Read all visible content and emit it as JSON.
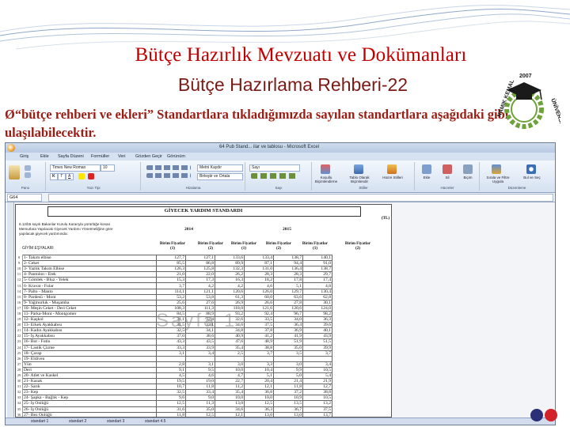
{
  "slide": {
    "title": "Bütçe Hazırlık Mevzuatı ve Dokümanları",
    "subtitle": "Bütçe Hazırlama Rehberi-22",
    "bullet_arrow": "Ø",
    "bullet_text": "“bütçe rehberi ve ekleri” Standartlara tıkladığımızda sayılan standartlara aşağıdaki gibi ulaşılabilecektir."
  },
  "logo": {
    "top_text": "2007",
    "left_text": "NAMIK KEMAL",
    "right_text": "ÜNİVERSİTESİ"
  },
  "excel": {
    "window_caption": "64 Pub Stand... ilar ve tablosu - Microsoft Excel",
    "ribbon_tabs": [
      "Giriş",
      "Ekle",
      "Sayfa Düzeni",
      "Formüller",
      "Veri",
      "Gözden Geçir",
      "Görünüm"
    ],
    "font_name": "Times New Roman",
    "font_size": "10",
    "number_format": "Sayı",
    "wrap_label": "Metni Kaydır",
    "merge_label": "Birleştir ve Ortala",
    "group_labels": [
      "Pano",
      "Yazı Tipi",
      "Hizalama",
      "Sayı",
      "Stiller",
      "Hücreler",
      "Düzenleme"
    ],
    "style_buttons": [
      "Koşullu Biçimlendirme",
      "Tablo Olarak Biçimlendir",
      "Hücre Stilleri"
    ],
    "cell_buttons": [
      "Ekle",
      "Sil",
      "Biçim"
    ],
    "edit_buttons": [
      "Sırala ve Filtre Uygula",
      "Bul ve Seç"
    ],
    "name_box": "G64",
    "sheet_tabs": [
      "standart 1",
      "standart 2",
      "standart 3",
      "standart 4.5"
    ],
    "watermark": "Sayfa 1"
  },
  "standard": {
    "title": "GİYECEK YARDIM STANDARDI",
    "tl_label": "(TL)",
    "intro": "6.12/b5 sayılı Bakanlar Kurulu Kararıyla yürürlüğe konan Memurlara Yapılacak Giyecek Yardımı Yönetmeliğine göre yapılacak giyecek yardımında:",
    "group_header": "GİYİM EŞYALARI",
    "years": [
      "2014",
      "2015"
    ],
    "col_headers": [
      "Birim Fiyatlar (1)",
      "Birim Fiyatlar (2)",
      "Birim Fiyatlar (1)",
      "Birim Fiyatlar (2)",
      "Birim Fiyatlar (1)",
      "Birim Fiyatlar (2)"
    ],
    "rows": [
      {
        "rn": "8",
        "name": "1- Takım elbise",
        "v": [
          "127,7",
          "127,1",
          "133,6",
          "133,4",
          "138,7",
          "140,1"
        ]
      },
      {
        "rn": "9",
        "name": "2- Ceket",
        "v": [
          "85,5",
          "86,8",
          "89,9",
          "87,1",
          "94,4",
          "91,0"
        ]
      },
      {
        "rn": "10",
        "name": "3- Yazlık Takım Elbise",
        "v": [
          "126,3",
          "125,8",
          "132,3",
          "131,0",
          "136,4",
          "138,7"
        ]
      },
      {
        "rn": "11",
        "name": "4- Pantolon - Etek",
        "v": [
          "21,0",
          "22,0",
          "26,2",
          "28,3",
          "28,3",
          "29,7"
        ]
      },
      {
        "rn": "12",
        "name": "5- Gömlek - Bluz - Yelek",
        "v": [
          "15,3",
          "17,3",
          "16,3",
          "18,2",
          "17,8",
          "17,4"
        ]
      },
      {
        "rn": "13",
        "name": "6- Kravat - Fular",
        "v": [
          "3,7",
          "4,2",
          "4,2",
          "4,6",
          "5,1",
          "4,8"
        ]
      },
      {
        "rn": "14",
        "name": "7- Palto - Manto",
        "v": [
          "114,1",
          "121,1",
          "120,6",
          "126,0",
          "129,7",
          "130,4"
        ]
      },
      {
        "rn": "15",
        "name": "8- Pardesü - Mont",
        "v": [
          "53,2",
          "53,8",
          "61,3",
          "60,0",
          "63,6",
          "62,8"
        ]
      },
      {
        "rn": "16",
        "name": "9- Yağmurluk - Muşamba",
        "v": [
          "25,6",
          "27,6",
          "26,9",
          "26,6",
          "27,8",
          "30,1"
        ]
      },
      {
        "rn": "17",
        "name": "10- Meşin Ceket - Deri Ceket",
        "v": [
          "108,3",
          "111,3",
          "118,0",
          "121,6",
          "120,6",
          "124,0"
        ]
      },
      {
        "rn": "18",
        "name": "11- Parka-Mont - Montgomer",
        "v": [
          "84,5",
          "88,9",
          "93,2",
          "92,4",
          "96,7",
          "98,2"
        ]
      },
      {
        "rn": "19",
        "name": "12- Kaşkol",
        "v": [
          "31,1",
          "32,4",
          "32,6",
          "33,5",
          "34,0",
          "36,3"
        ]
      },
      {
        "rn": "20",
        "name": "13- Erkek Ayakkabısı",
        "v": [
          "31,5",
          "33,1",
          "34,6",
          "37,5",
          "36,4",
          "39,6"
        ]
      },
      {
        "rn": "21",
        "name": "14- Kadın Ayakkabısı",
        "v": [
          "32,5",
          "34,1",
          "34,8",
          "37,8",
          "36,9",
          "40,1"
        ]
      },
      {
        "rn": "22",
        "name": "15- İş Ayakkabısı",
        "v": [
          "37,0",
          "38,6",
          "40,9",
          "41,2",
          "41,9",
          "43,9"
        ]
      },
      {
        "rn": "23",
        "name": "16- Bot - Fotin",
        "v": [
          "43,3",
          "43,5",
          "47,6",
          "48,9",
          "51,9",
          "51,5"
        ]
      },
      {
        "rn": "24",
        "name": "17- Lastik Çizme",
        "v": [
          "33,3",
          "33,9",
          "35,4",
          "38,8",
          "35,0",
          "39,9"
        ]
      },
      {
        "rn": "25",
        "name": "18- Çorap",
        "v": [
          "3,1",
          "3,4",
          "2,5",
          "3,7",
          "3,5",
          "3,7"
        ]
      },
      {
        "rn": "26",
        "name": "19- Eldiven",
        "v": [
          "",
          "",
          "",
          "",
          "",
          ""
        ]
      },
      {
        "rn": "27",
        "name": "      Yün",
        "v": [
          "2,8",
          "3,1",
          "3,0",
          "3,3",
          "3,0",
          "3,4"
        ]
      },
      {
        "rn": "28",
        "name": "      Deri",
        "v": [
          "9,1",
          "9,5",
          "10,0",
          "10,4",
          "9,9",
          "10,5"
        ]
      },
      {
        "rn": "29",
        "name": "20- Atlet ve Kaskel",
        "v": [
          "4,5",
          "4,6",
          "4,7",
          "5,1",
          "5,0",
          "5,4"
        ]
      },
      {
        "rn": "30",
        "name": "21- Kazak",
        "v": [
          "19,5",
          "19,0",
          "22,7",
          "20,4",
          "21,4",
          "21,9"
        ]
      },
      {
        "rn": "31",
        "name": "22- Sarık",
        "v": [
          "10,7",
          "11,8",
          "11,2",
          "12,1",
          "11,8",
          "12,7"
        ]
      },
      {
        "rn": "32",
        "name": "23- Kep",
        "v": [
          "32,5",
          "33,4",
          "35,4",
          "36,8",
          "37,2",
          "38,8"
        ]
      },
      {
        "rn": "33",
        "name": "24- Şapka - Bağlık - Kep",
        "v": [
          "9,6",
          "9,0",
          "10,0",
          "10,0",
          "10,9",
          "10,5"
        ]
      },
      {
        "rn": "34",
        "name": "25- İş Önlüğü",
        "v": [
          "12,5",
          "11,3",
          "13,0",
          "12,5",
          "13,5",
          "13,2"
        ]
      },
      {
        "rn": "35",
        "name": "26- İş Önlüğü",
        "v": [
          "31,6",
          "35,0",
          "34,6",
          "36,3",
          "36,7",
          "37,5"
        ]
      },
      {
        "rn": "36",
        "name": "27- Bez Önlüğü",
        "v": [
          "11,8",
          "12,5",
          "12,1",
          "13,0",
          "13,0",
          "13,7"
        ]
      },
      {
        "rn": "37",
        "name": "28- İş Gömleği",
        "v": [
          "25,4",
          "32,5",
          "27,0",
          "33,6",
          "28,6",
          "34,4"
        ]
      }
    ]
  }
}
